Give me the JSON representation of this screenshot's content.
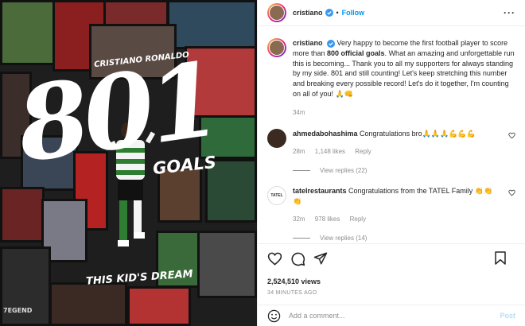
{
  "media": {
    "name_text": "CRISTIANO RONALDO",
    "big_number": "801",
    "goals_text": "GOALS",
    "dream_text": "THIS KID'S DREAM",
    "edition_text": "7EGEND"
  },
  "header": {
    "username": "cristiano",
    "follow_label": "Follow",
    "separator": "•",
    "more_label": "···"
  },
  "caption": {
    "username": "cristiano",
    "text_before": "Very happy to become the first football player to score more than ",
    "bold_part": "800 official goals",
    "text_after": ". What an amazing and unforgettable run this is becoming... Thank you to all my supporters for always standing by my side. 801 and still counting! Let's keep stretching this number and breaking every possible record! Let's do it together, I'm counting on all of you! 🙏👊",
    "time": "34m"
  },
  "comments": [
    {
      "username": "ahmedabohashima",
      "text": "Congratulations bro🙏🙏🙏💪💪💪",
      "time": "28m",
      "likes": "1,148 likes",
      "reply_label": "Reply",
      "view_replies": "View replies (22)"
    },
    {
      "username": "tatelrestaurants",
      "text": "Congratulations from the TATEL Family 👏👏👏",
      "time": "32m",
      "likes": "978 likes",
      "reply_label": "Reply",
      "view_replies": "View replies (14)",
      "avatar_text": "TATEL"
    }
  ],
  "stats": {
    "views": "2,524,510 views",
    "ago": "34 MINUTES AGO"
  },
  "add_comment": {
    "placeholder": "Add a comment...",
    "post_label": "Post"
  },
  "colors": {
    "link_blue": "#0095f6",
    "post_disabled": "#b2dffc",
    "muted": "#8e8e8e",
    "verified": "#3897f0"
  }
}
